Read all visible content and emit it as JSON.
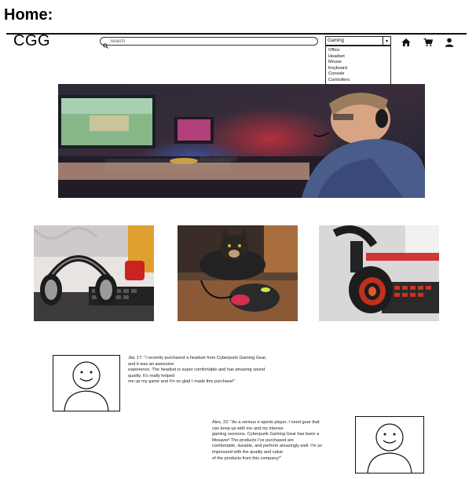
{
  "page": {
    "heading": "Home:"
  },
  "header": {
    "logo": "CGG",
    "search_placeholder": "Search",
    "category_selected": "Gaming",
    "category_options": [
      "Office",
      "Headset",
      "Mouse",
      "Keyboard",
      "Console",
      "Controllers"
    ],
    "icons": [
      "home-icon",
      "cart-icon",
      "user-icon"
    ]
  },
  "hero": {
    "caption": "Hello random text"
  },
  "products": [
    {
      "name": "headset-on-desk"
    },
    {
      "name": "cat-with-mouse"
    },
    {
      "name": "red-headset"
    }
  ],
  "testimonials": [
    {
      "lines": [
        "Jiw, 17: \"I recently purchased a headset from Cyberpunk Gaming Gear,",
        "and it was an awesome",
        "experience. The headset is super comfortable and has amazing sound",
        "quality. It's really helped",
        "me up my game and I'm so glad I made this purchase!\""
      ]
    },
    {
      "lines": [
        "Alex, 22: \"As a serious e-sports player, I need gear that",
        "can keep up with me and my intense",
        "gaming sessions. Cyberpunk Gaming Gear has been a",
        "lifesaver! The products I've purchased are",
        "comfortable, durable, and perform amazingly well. I'm so",
        "impressed with the quality and value",
        "of the products from this company!\""
      ]
    }
  ],
  "colors": {
    "accent": "#e0245e",
    "text": "#111111"
  }
}
